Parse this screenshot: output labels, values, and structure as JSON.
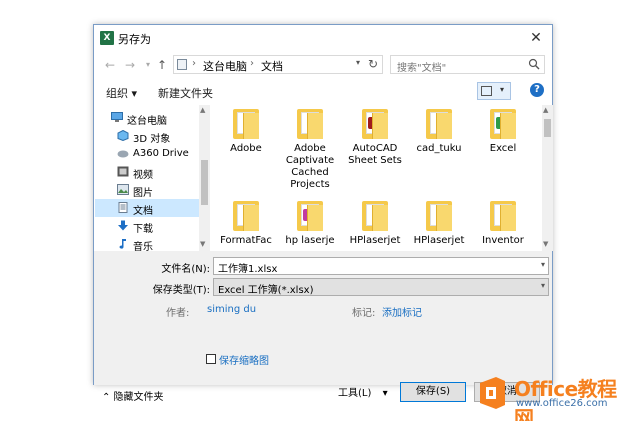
{
  "window": {
    "title": "另存为",
    "app_icon_letter": "X"
  },
  "address": {
    "crumbs": [
      "这台电脑",
      "文档"
    ],
    "search_placeholder": "搜索\"文档\""
  },
  "toolbar": {
    "organize": "组织 ▾",
    "new_folder": "新建文件夹",
    "help": "?"
  },
  "nav": [
    {
      "label": "这台电脑",
      "icon": "computer-icon"
    },
    {
      "label": "3D 对象",
      "icon": "cube-icon"
    },
    {
      "label": "A360 Drive",
      "icon": "cloud-drive-icon"
    },
    {
      "label": "视频",
      "icon": "video-icon"
    },
    {
      "label": "图片",
      "icon": "picture-icon"
    },
    {
      "label": "文档",
      "icon": "document-icon",
      "selected": true
    },
    {
      "label": "下载",
      "icon": "download-icon"
    },
    {
      "label": "音乐",
      "icon": "music-icon"
    }
  ],
  "files": [
    {
      "label": "Adobe",
      "emblem": ""
    },
    {
      "label": "Adobe Captivate Cached Projects",
      "emblem": ""
    },
    {
      "label": "AutoCAD Sheet Sets",
      "emblem": "#a01c1c"
    },
    {
      "label": "cad_tuku",
      "emblem": ""
    },
    {
      "label": "Excel",
      "emblem": "#2e9b4a"
    },
    {
      "label": "FormatFac",
      "emblem": ""
    },
    {
      "label": "hp laserje",
      "emblem": "#c23aa0"
    },
    {
      "label": "HPlaserjet",
      "emblem": "#d0d0d0"
    },
    {
      "label": "HPlaserjet",
      "emblem": "#d0d0d0"
    },
    {
      "label": "Inventor",
      "emblem": ""
    }
  ],
  "form": {
    "filename_label": "文件名(N):",
    "filename_value": "工作簿1.xlsx",
    "type_label": "保存类型(T):",
    "type_value": "Excel 工作簿(*.xlsx)",
    "author_label": "作者:",
    "author_value": "siming du",
    "tags_label": "标记:",
    "tags_value": "添加标记",
    "thumbnail_label": "保存缩略图"
  },
  "footer": {
    "hide_folders": "⌃ 隐藏文件夹",
    "tools": "工具(L)",
    "save": "保存(S)",
    "cancel": "取消"
  },
  "watermark": {
    "title": "Office教程网",
    "url": "www.office26.com"
  }
}
